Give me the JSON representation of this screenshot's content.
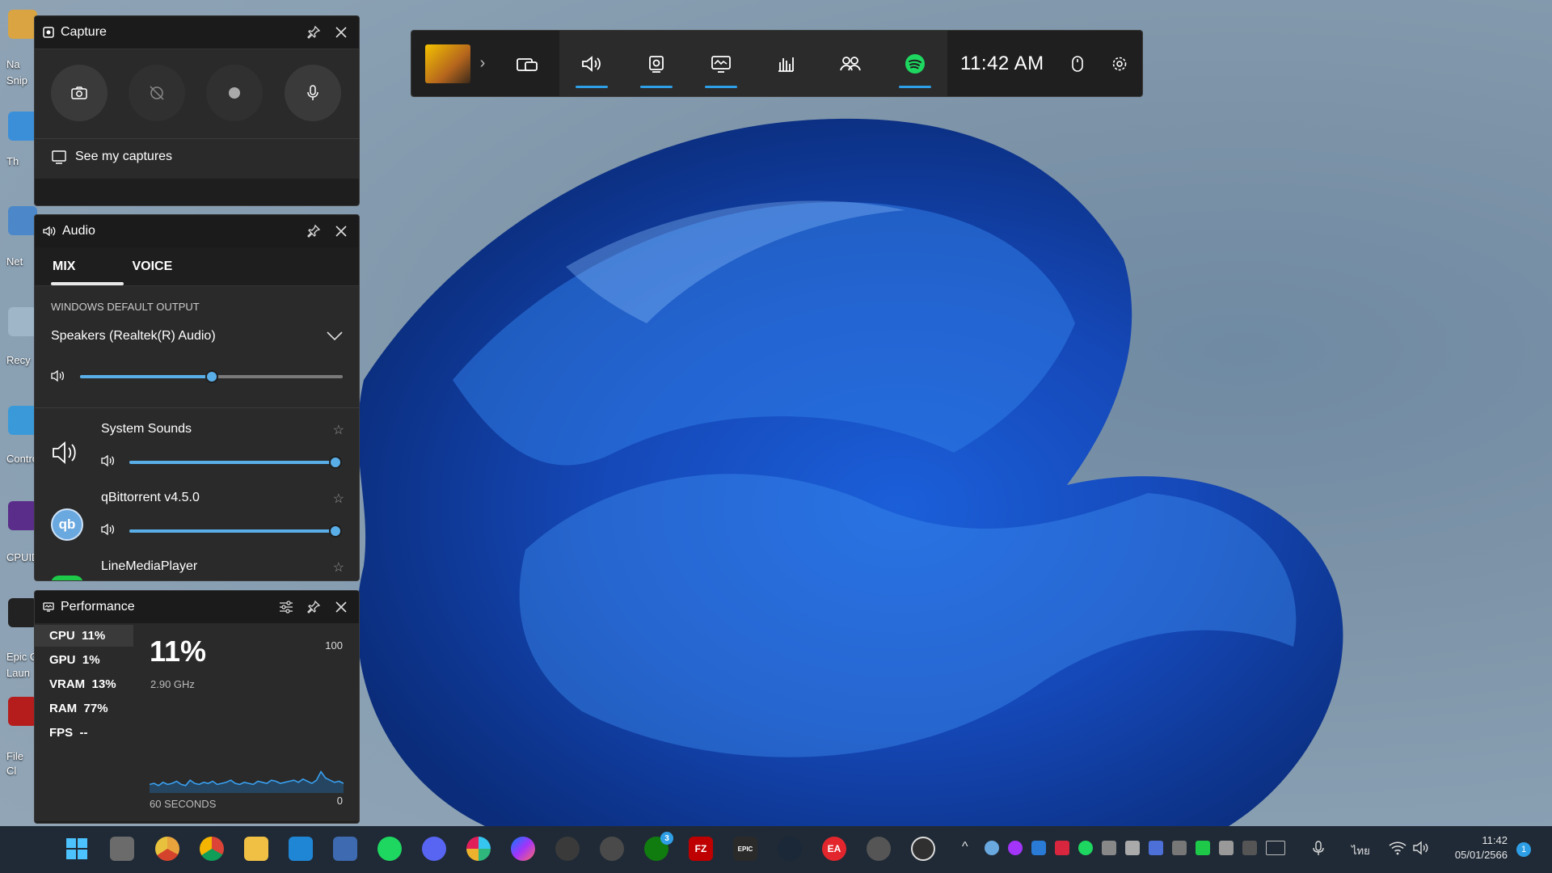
{
  "colors": {
    "accent": "#2e9fe6",
    "panel_bg": "#2a2a2a",
    "spotify": "#1ed760"
  },
  "desktop": {
    "labels": [
      "Na",
      "Snip",
      "Th",
      "Net",
      "Recy",
      "Contro",
      "CPUID",
      "Epic G",
      "Laun",
      "File",
      "Cl"
    ]
  },
  "gamebar": {
    "time": "11:42 AM",
    "widgets": [
      "widget-menu-icon",
      "audio-icon",
      "capture-icon",
      "performance-icon",
      "resources-icon",
      "xbox-social-icon",
      "spotify-icon"
    ],
    "active": [
      "audio-icon",
      "capture-icon",
      "performance-icon",
      "spotify-icon"
    ]
  },
  "capture": {
    "title": "Capture",
    "see_captures": "See my captures",
    "buttons": [
      "screenshot-icon",
      "record-last-icon",
      "record-icon",
      "microphone-icon"
    ]
  },
  "audio": {
    "title": "Audio",
    "tabs": [
      "MIX",
      "VOICE"
    ],
    "active_tab": "MIX",
    "output_label": "WINDOWS DEFAULT OUTPUT",
    "output_device": "Speakers (Realtek(R) Audio)",
    "master_volume": 0.5,
    "apps": [
      {
        "name": "System Sounds",
        "volume": 1.0,
        "icon": "speaker-icon"
      },
      {
        "name": "qBittorrent v4.5.0",
        "volume": 1.0,
        "icon": "qb"
      },
      {
        "name": "LineMediaPlayer",
        "volume": 1.0,
        "icon": "line-icon"
      }
    ]
  },
  "performance": {
    "title": "Performance",
    "metrics": [
      {
        "name": "CPU",
        "value": "11%"
      },
      {
        "name": "GPU",
        "value": "1%"
      },
      {
        "name": "VRAM",
        "value": "13%"
      },
      {
        "name": "RAM",
        "value": "77%"
      },
      {
        "name": "FPS",
        "value": "--"
      }
    ],
    "selected": "CPU",
    "big_value": "11%",
    "freq": "2.90 GHz",
    "max_label": "100",
    "min_label": "0",
    "duration_label": "60 SECONDS",
    "cpu_history": [
      8,
      9,
      7,
      10,
      8,
      9,
      11,
      8,
      7,
      12,
      9,
      8,
      10,
      9,
      11,
      8,
      9,
      10,
      12,
      9,
      8,
      10,
      9,
      8,
      11,
      10,
      9,
      12,
      11,
      9,
      10,
      11,
      12,
      10,
      13,
      11,
      9,
      12,
      20,
      14,
      12,
      10,
      11,
      9
    ]
  },
  "taskbar": {
    "clock_time": "11:42",
    "clock_date": "05/01/2566",
    "lang": "ไทย",
    "notif_count": "1",
    "xbox_badge": "3",
    "apps": [
      "windows-start-icon",
      "task-view-icon",
      "chrome-canary-icon",
      "chrome-icon",
      "file-explorer-icon",
      "vscode-icon",
      "network-icon",
      "spotify-icon",
      "discord-icon",
      "slack-icon",
      "messenger-icon",
      "vpn-icon",
      "steam-companion-icon",
      "xbox-icon",
      "filezilla-icon",
      "epic-games-icon",
      "steam-icon",
      "ea-icon",
      "obs-like-icon",
      "obs-icon"
    ]
  }
}
